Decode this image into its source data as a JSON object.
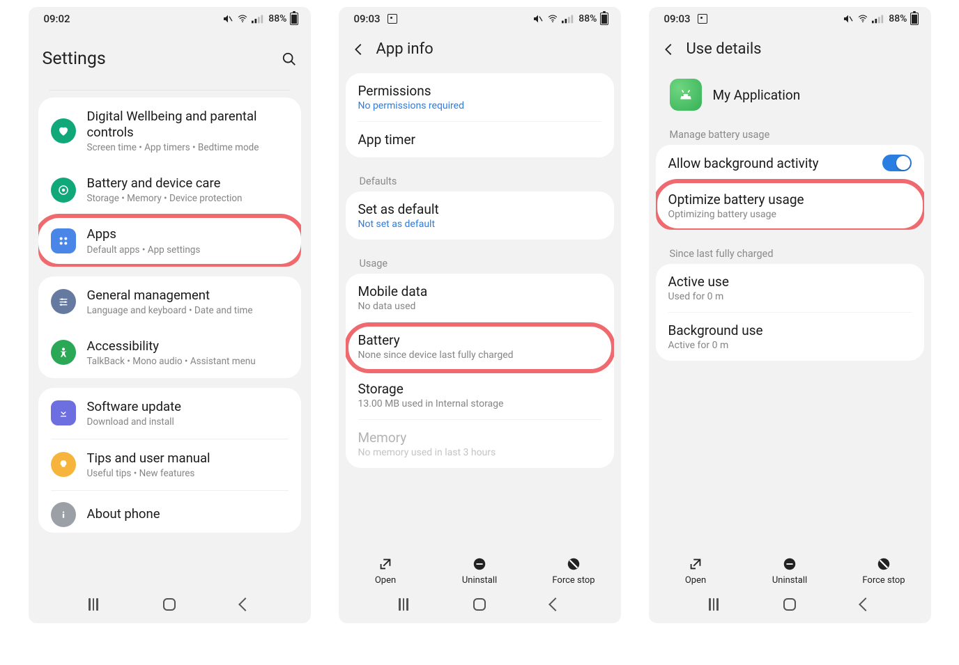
{
  "status": {
    "battery_pct": "88%"
  },
  "screen1": {
    "time": "09:02",
    "title": "Settings",
    "items": [
      {
        "label": "Digital Wellbeing and parental controls",
        "sub": "Screen time  •  App timers  •  Bedtime mode",
        "color": "#10a878",
        "icon": "heart"
      },
      {
        "label": "Battery and device care",
        "sub": "Storage  •  Memory  •  Device protection",
        "color": "#10a878",
        "icon": "care"
      },
      {
        "label": "Apps",
        "sub": "Default apps  •  App settings",
        "color": "#4a86e8",
        "icon": "grid"
      },
      {
        "label": "General management",
        "sub": "Language and keyboard  •  Date and time",
        "color": "#6679a0",
        "icon": "sliders"
      },
      {
        "label": "Accessibility",
        "sub": "TalkBack  •  Mono audio  •  Assistant menu",
        "color": "#2aa855",
        "icon": "person"
      },
      {
        "label": "Software update",
        "sub": "Download and install",
        "color": "#6d6fe0",
        "icon": "update"
      },
      {
        "label": "Tips and user manual",
        "sub": "Useful tips  •  New features",
        "color": "#f6b43c",
        "icon": "bulb"
      },
      {
        "label": "About phone",
        "sub": "",
        "color": "#9aa0a6",
        "icon": "info"
      }
    ]
  },
  "screen2": {
    "time": "09:03",
    "title": "App info",
    "permissions": {
      "label": "Permissions",
      "sub": "No permissions required"
    },
    "app_timer": {
      "label": "App timer"
    },
    "defaults_header": "Defaults",
    "set_default": {
      "label": "Set as default",
      "sub": "Not set as default"
    },
    "usage_header": "Usage",
    "mobile_data": {
      "label": "Mobile data",
      "sub": "No data used"
    },
    "battery": {
      "label": "Battery",
      "sub": "None since device last fully charged"
    },
    "storage": {
      "label": "Storage",
      "sub": "13.00 MB used in Internal storage"
    },
    "memory": {
      "label": "Memory",
      "sub": "No memory used in last 3 hours"
    },
    "actions": {
      "open": "Open",
      "uninstall": "Uninstall",
      "force_stop": "Force stop"
    }
  },
  "screen3": {
    "time": "09:03",
    "title": "Use details",
    "app_name": "My Application",
    "manage_header": "Manage battery usage",
    "allow_bg": {
      "label": "Allow background activity"
    },
    "optimize": {
      "label": "Optimize battery usage",
      "sub": "Optimizing battery usage"
    },
    "since_header": "Since last fully charged",
    "active": {
      "label": "Active use",
      "sub": "Used for 0 m"
    },
    "background": {
      "label": "Background use",
      "sub": "Active for 0 m"
    },
    "actions": {
      "open": "Open",
      "uninstall": "Uninstall",
      "force_stop": "Force stop"
    }
  }
}
